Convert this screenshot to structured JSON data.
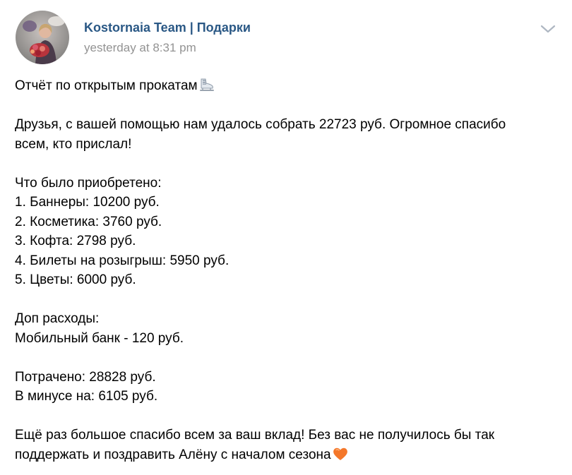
{
  "post": {
    "author": "Kostornaia Team | Подарки",
    "time": "yesterday at 8:31 pm",
    "avatar_icon": "group-avatar-photo",
    "menu_icon": "chevron-down-icon",
    "colors": {
      "author_link": "#2a5885",
      "time": "#939393",
      "text": "#000000",
      "chevron": "#aeb7c2"
    },
    "body": {
      "title": "Отчёт по открытым прокатам",
      "title_emoji": "ice-skate-emoji",
      "thanks_line1": "Друзья, с вашей помощью нам удалось собрать 22723 руб. Огромное спасибо",
      "thanks_line2": "всем, кто прислал!",
      "purchased_heading": "Что было приобретено:",
      "items": [
        "1. Баннеры: 10200 руб.",
        "2. Косметика: 3760 руб.",
        "3. Кофта: 2798 руб.",
        "4. Билеты на розыгрыш: 5950 руб.",
        "5. Цветы: 6000 руб."
      ],
      "extra_heading": "Доп расходы:",
      "extra_item": "Мобильный банк - 120 руб.",
      "spent": "Потрачено: 28828 руб.",
      "deficit": "В минусе на: 6105 руб.",
      "closing_line1": "Ещё раз большое спасибо всем за ваш вклад! Без вас не получилось бы так",
      "closing_line2": "поддержать и поздравить Алёну с началом сезона",
      "closing_emoji": "orange-heart-emoji"
    }
  }
}
